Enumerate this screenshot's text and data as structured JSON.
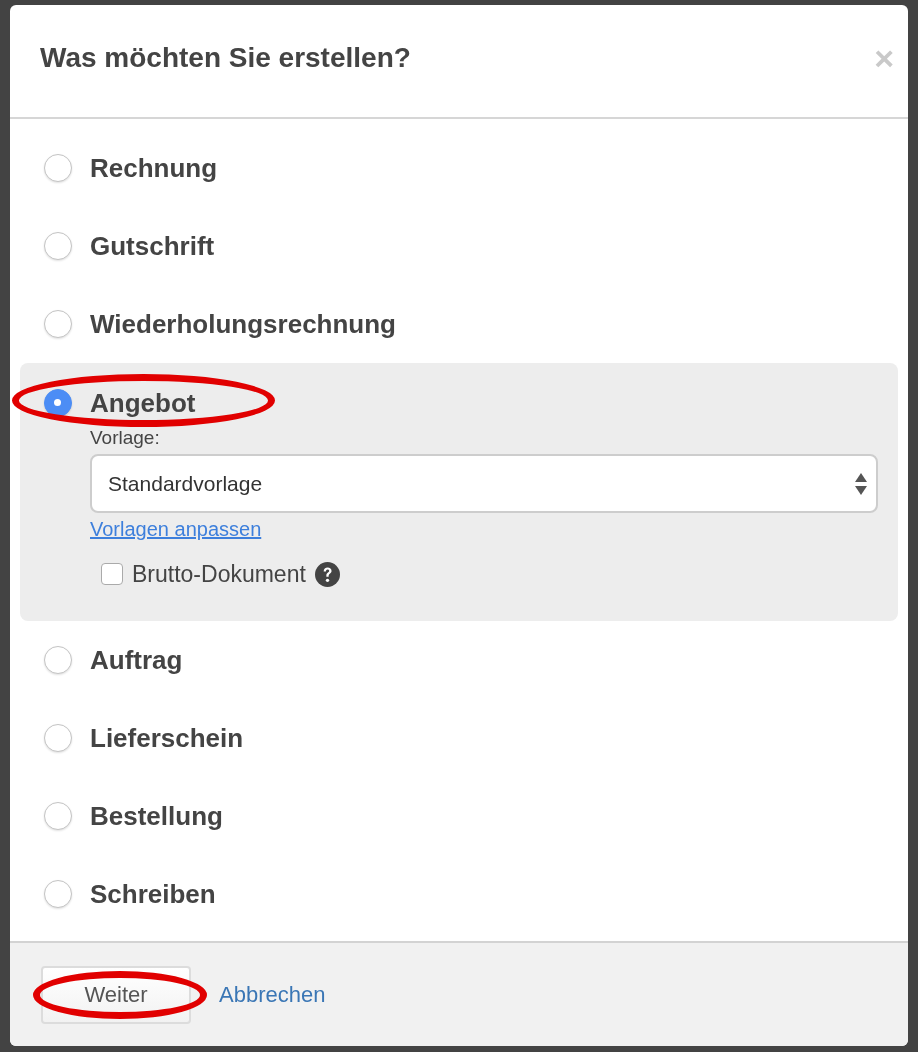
{
  "dialog": {
    "title": "Was möchten Sie erstellen?",
    "close_label": "×"
  },
  "options": [
    {
      "label": "Rechnung",
      "selected": false,
      "highlighted": false
    },
    {
      "label": "Gutschrift",
      "selected": false,
      "highlighted": false
    },
    {
      "label": "Wiederholungsrechnung",
      "selected": false,
      "highlighted": false
    },
    {
      "label": "Angebot",
      "selected": true,
      "highlighted": true,
      "template": {
        "label": "Vorlage:",
        "value": "Standardvorlage"
      },
      "link": "Vorlagen anpassen",
      "gross_document": {
        "label": "Brutto-Dokument",
        "checked": false
      }
    },
    {
      "label": "Auftrag",
      "selected": false,
      "highlighted": false
    },
    {
      "label": "Lieferschein",
      "selected": false,
      "highlighted": false
    },
    {
      "label": "Bestellung",
      "selected": false,
      "highlighted": false
    },
    {
      "label": "Schreiben",
      "selected": false,
      "highlighted": false
    }
  ],
  "footer": {
    "buttons": [
      {
        "label": "Weiter",
        "kind": "button",
        "highlighted": true
      },
      {
        "label": "Abbrechen",
        "kind": "link",
        "highlighted": false
      }
    ]
  }
}
